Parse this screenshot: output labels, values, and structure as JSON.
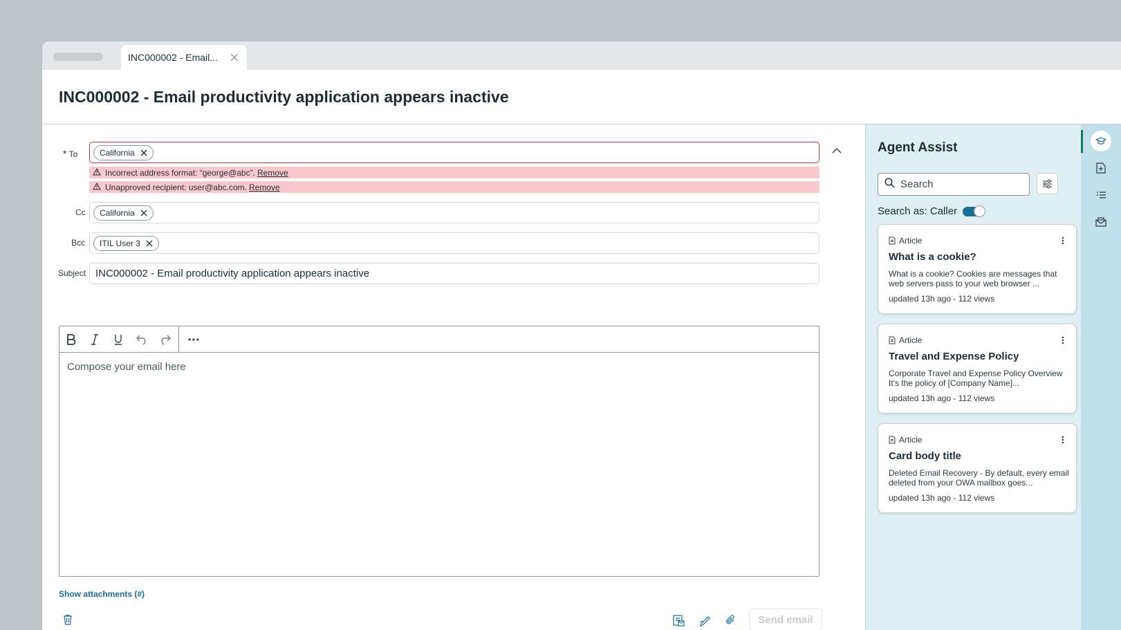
{
  "tab": {
    "label": "INC000002 - Email..."
  },
  "page": {
    "title": "INC000002 - Email productivity application appears inactive"
  },
  "composer": {
    "to_label": "To",
    "required_mark": "*",
    "cc_label": "Cc",
    "bcc_label": "Bcc",
    "subject_label": "Subject",
    "to_recipients": [
      "California"
    ],
    "cc_recipients": [
      "California"
    ],
    "bcc_recipients": [
      "ITIL User 3"
    ],
    "errors": [
      {
        "message": "Incorrect address format: “george@abc”.",
        "action": "Remove"
      },
      {
        "message": "Unapproved recipient: user@abc.com.",
        "action": "Remove"
      }
    ],
    "subject_value": "INC000002 - Email productivity application appears inactive",
    "body_placeholder": "Compose your email here",
    "show_attachments": "Show attachments (#)",
    "send_label": "Send email"
  },
  "assist": {
    "title": "Agent Assist",
    "search_placeholder": "Search",
    "search_as": "Search as: Caller",
    "cards": [
      {
        "type": "Article",
        "title": "What is a cookie?",
        "desc": "What is a cookie? Cookies are messages that web servers pass to your web browser ...",
        "meta": "updated 13h ago - 112 views"
      },
      {
        "type": "Article",
        "title": "Travel and Expense Policy",
        "desc": "Corporate Travel and Expense Policy Overview It's the policy of [Company Name]...",
        "meta": "updated 13h ago - 112 views"
      },
      {
        "type": "Article",
        "title": "Card body title",
        "desc": "Deleted Email Recovery - By default, every email deleted from your OWA mailbox goes...",
        "meta": "updated 13h ago - 112 views"
      }
    ]
  },
  "colors": {
    "accent": "#1a6f96",
    "error_border": "#d1323f",
    "error_bg": "#f9c8cd",
    "assist_bg": "#e0eff3",
    "rail_bg": "#bfe0ea"
  },
  "icons": {
    "rail": [
      "graduation-cap-icon",
      "add-document-icon",
      "list-icon",
      "mail-template-icon"
    ],
    "footer": [
      "template-icon",
      "signature-icon",
      "paperclip-icon"
    ]
  }
}
